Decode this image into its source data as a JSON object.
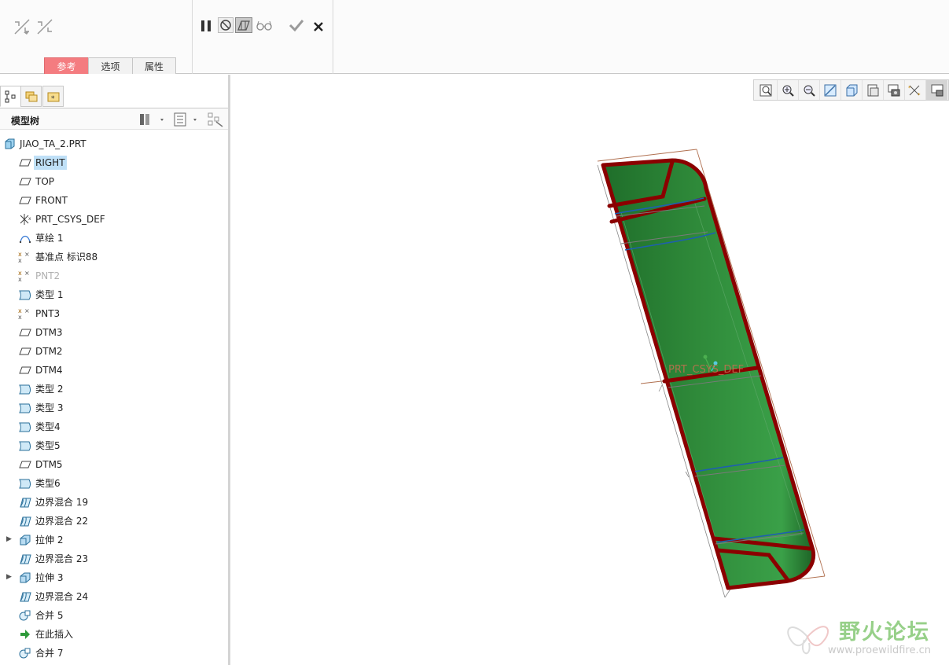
{
  "ribbon": {
    "tabs": [
      {
        "label": "参考",
        "active": true
      },
      {
        "label": "选项",
        "active": false
      },
      {
        "label": "属性",
        "active": false
      }
    ],
    "left_icons": [
      "edge-chain-icon",
      "edge-chain-alt-icon"
    ],
    "controls": [
      "pause-icon",
      "no-preview-icon",
      "verify-preview-icon",
      "glasses-preview-icon",
      "confirm-icon",
      "cancel-icon"
    ]
  },
  "panel": {
    "tabs": [
      "model-tree-tab-icon",
      "folder-browser-tab-icon",
      "favorites-tab-icon"
    ],
    "tree_title": "模型树",
    "items": [
      {
        "label": "JIAO_TA_2.PRT",
        "icon": "part-icon",
        "root": true
      },
      {
        "label": "RIGHT",
        "icon": "datum-plane-icon",
        "selected": true
      },
      {
        "label": "TOP",
        "icon": "datum-plane-icon"
      },
      {
        "label": "FRONT",
        "icon": "datum-plane-icon"
      },
      {
        "label": "PRT_CSYS_DEF",
        "icon": "csys-icon"
      },
      {
        "label": "草绘 1",
        "icon": "sketch-icon"
      },
      {
        "label": "基准点 标识88",
        "icon": "datum-point-icon"
      },
      {
        "label": "PNT2",
        "icon": "datum-point-icon",
        "dim": true
      },
      {
        "label": "类型 1",
        "icon": "surface-icon"
      },
      {
        "label": "PNT3",
        "icon": "datum-point-icon"
      },
      {
        "label": "DTM3",
        "icon": "datum-plane-icon"
      },
      {
        "label": "DTM2",
        "icon": "datum-plane-icon"
      },
      {
        "label": "DTM4",
        "icon": "datum-plane-icon"
      },
      {
        "label": "类型 2",
        "icon": "surface-icon"
      },
      {
        "label": "类型 3",
        "icon": "surface-icon"
      },
      {
        "label": "类型4",
        "icon": "surface-icon"
      },
      {
        "label": "类型5",
        "icon": "surface-icon"
      },
      {
        "label": "DTM5",
        "icon": "datum-plane-icon"
      },
      {
        "label": "类型6",
        "icon": "surface-icon"
      },
      {
        "label": "边界混合 19",
        "icon": "boundary-blend-icon"
      },
      {
        "label": "边界混合 22",
        "icon": "boundary-blend-icon"
      },
      {
        "label": "拉伸 2",
        "icon": "extrude-icon",
        "expandable": true
      },
      {
        "label": "边界混合 23",
        "icon": "boundary-blend-icon"
      },
      {
        "label": "拉伸 3",
        "icon": "extrude-icon",
        "expandable": true
      },
      {
        "label": "边界混合 24",
        "icon": "boundary-blend-icon"
      },
      {
        "label": "合并 5",
        "icon": "merge-icon"
      },
      {
        "label": "在此插入",
        "icon": "insert-here-icon"
      },
      {
        "label": "合并 7",
        "icon": "merge-icon"
      }
    ]
  },
  "view_toolbar": [
    "refit-icon",
    "zoom-in-icon",
    "zoom-out-icon",
    "repaint-icon",
    "display-style-icon",
    "saved-views-icon",
    "view-manager-icon",
    "datum-display-icon",
    "annotation-display-icon"
  ],
  "graphics": {
    "csys_label": "PRT_CSYS_DEF",
    "colors": {
      "surface": "#2f8a3a",
      "edge": "#8b0000",
      "highlight": "#1e5fb0"
    }
  },
  "watermark": {
    "title": "野火论坛",
    "url": "www.proewildfire.cn"
  }
}
